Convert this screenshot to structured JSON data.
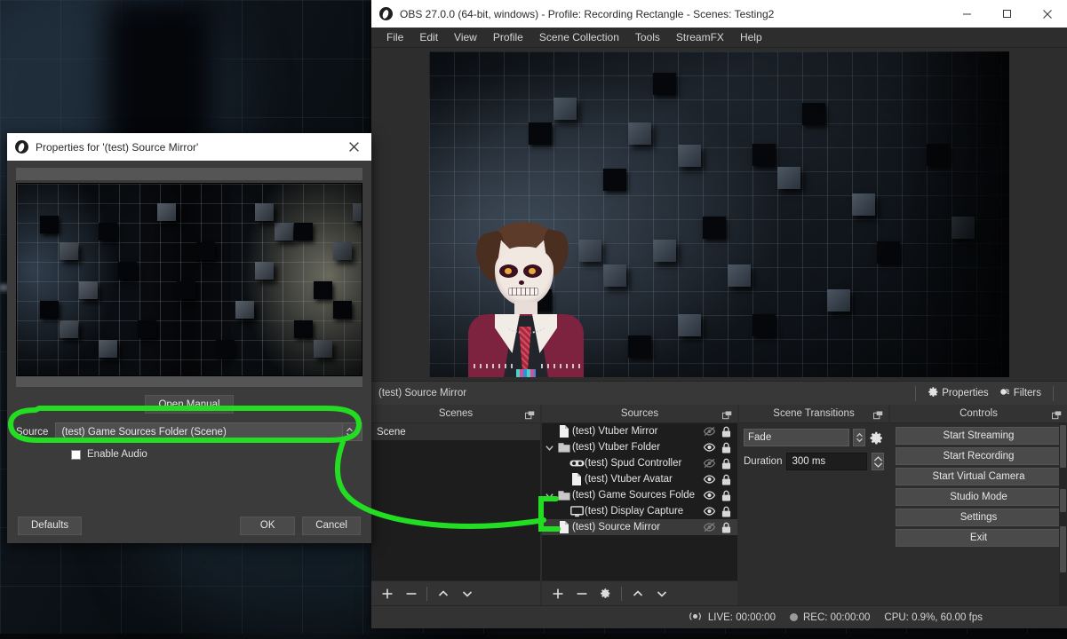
{
  "desktop": {
    "wallpaper_name": "dark-cube-grid-wallpaper"
  },
  "obs_window": {
    "title": "OBS 27.0.0 (64-bit, windows) - Profile: Recording Rectangle - Scenes: Testing2",
    "logo_icon": "obs-logo-icon",
    "window_buttons": {
      "minimize": "minimize-icon",
      "maximize": "maximize-icon",
      "close": "close-icon"
    },
    "menubar": [
      {
        "label": "File"
      },
      {
        "label": "Edit"
      },
      {
        "label": "View"
      },
      {
        "label": "Profile"
      },
      {
        "label": "Scene Collection"
      },
      {
        "label": "Tools"
      },
      {
        "label": "StreamFX"
      },
      {
        "label": "Help"
      }
    ],
    "preview": {
      "content_name": "dark-cube-wall-with-vtuber-avatar"
    },
    "source_toolbar": {
      "selected_source": "(test) Source Mirror",
      "properties_label": "Properties",
      "properties_icon": "gear-icon",
      "filters_label": "Filters",
      "filters_icon": "filters-icon"
    },
    "docks": {
      "scenes": {
        "title": "Scenes",
        "float_icon": "undock-icon",
        "items": [
          {
            "label": "Scene",
            "selected": true
          }
        ],
        "footer": [
          {
            "icon": "plus-icon",
            "name": "add-scene-button"
          },
          {
            "icon": "minus-icon",
            "name": "remove-scene-button"
          },
          {
            "icon": "chevron-up-icon",
            "name": "move-scene-up-button"
          },
          {
            "icon": "chevron-down-icon",
            "name": "move-scene-down-button"
          }
        ]
      },
      "sources": {
        "title": "Sources",
        "float_icon": "undock-icon",
        "items": [
          {
            "label": "(test) Vtuber Mirror",
            "icon": "document-icon",
            "indent": 0,
            "expander": "",
            "visible": false,
            "locked": true
          },
          {
            "label": "(test) Vtuber Folder",
            "icon": "folder-icon",
            "indent": 0,
            "expander": "down",
            "visible": true,
            "locked": true
          },
          {
            "label": "(test) Spud Controller",
            "icon": "goggles-icon",
            "indent": 1,
            "expander": "",
            "visible": false,
            "locked": true
          },
          {
            "label": "(test) Vtuber Avatar",
            "icon": "document-icon",
            "indent": 1,
            "expander": "",
            "visible": true,
            "locked": true
          },
          {
            "label": "(test) Game Sources Folde",
            "icon": "folder-icon",
            "indent": 0,
            "expander": "down",
            "visible": true,
            "locked": true
          },
          {
            "label": "(test) Display Capture",
            "icon": "monitor-icon",
            "indent": 1,
            "expander": "",
            "visible": true,
            "locked": true
          },
          {
            "label": "(test) Source Mirror",
            "icon": "document-icon",
            "indent": 0,
            "expander": "",
            "visible": false,
            "locked": true,
            "selected": true
          }
        ],
        "footer": [
          {
            "icon": "plus-icon",
            "name": "add-source-button"
          },
          {
            "icon": "minus-icon",
            "name": "remove-source-button"
          },
          {
            "icon": "gear-icon",
            "name": "source-properties-button"
          },
          {
            "icon": "chevron-up-icon",
            "name": "move-source-up-button"
          },
          {
            "icon": "chevron-down-icon",
            "name": "move-source-down-button"
          }
        ]
      },
      "scene_transitions": {
        "title": "Scene Transitions",
        "float_icon": "undock-icon",
        "transition_value": "Fade",
        "gear_icon": "gear-icon",
        "duration_label": "Duration",
        "duration_value": "300 ms"
      },
      "controls": {
        "title": "Controls",
        "float_icon": "undock-icon",
        "buttons": [
          {
            "label": "Start Streaming"
          },
          {
            "label": "Start Recording"
          },
          {
            "label": "Start Virtual Camera"
          },
          {
            "label": "Studio Mode"
          },
          {
            "label": "Settings"
          },
          {
            "label": "Exit"
          }
        ]
      }
    },
    "statusbar": {
      "live_icon": "broadcast-icon",
      "live": "LIVE: 00:00:00",
      "rec_icon": "record-dot-icon",
      "rec": "REC: 00:00:00",
      "cpu": "CPU: 0.9%, 60.00 fps"
    }
  },
  "properties_dialog": {
    "title": "Properties for '(test) Source Mirror'",
    "logo_icon": "obs-logo-icon",
    "close_icon": "close-icon",
    "preview_name": "source-mirror-preview",
    "open_manual_label": "Open Manual",
    "source_label": "Source",
    "source_value": "(test) Game Sources Folder (Scene)",
    "enable_audio_label": "Enable Audio",
    "enable_audio_checked": false,
    "defaults_label": "Defaults",
    "ok_label": "OK",
    "cancel_label": "Cancel"
  },
  "annotation": {
    "name": "green-highlight-annotation",
    "color": "#22dd22",
    "stroke_width": 6,
    "description": "Green ellipse around the Source dropdown connected by a curved line and bracket to the (test) Game Sources Folder entry in the Sources list"
  },
  "colors": {
    "obs_bg": "#2d2d2d",
    "dock_bg": "#1d1d1d",
    "dock_title_bg": "#333333",
    "button_bg": "#4a4a4a",
    "titlebar_bg": "#ffffff",
    "annotation_green": "#22dd22",
    "dialog_bg": "#3b3b3b"
  }
}
